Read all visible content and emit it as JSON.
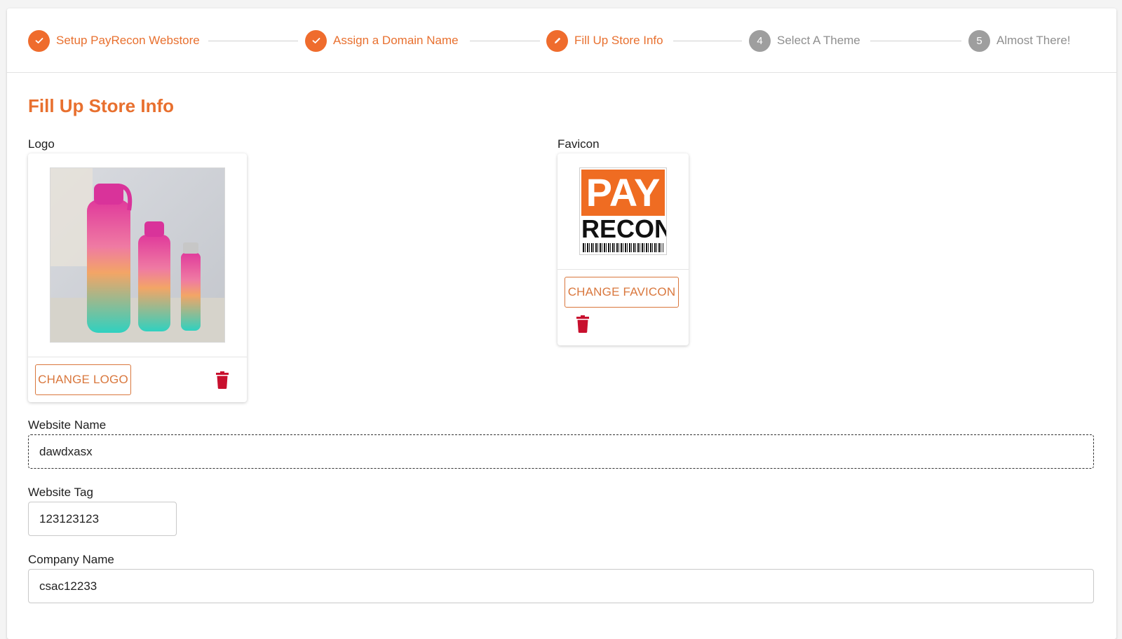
{
  "stepper": {
    "steps": [
      {
        "number": "",
        "label": "Setup PayRecon Webstore",
        "status": "completed"
      },
      {
        "number": "",
        "label": "Assign a Domain Name",
        "status": "completed"
      },
      {
        "number": "",
        "label": "Fill Up Store Info",
        "status": "current"
      },
      {
        "number": "4",
        "label": "Select A Theme",
        "status": "pending"
      },
      {
        "number": "5",
        "label": "Almost There!",
        "status": "pending"
      }
    ]
  },
  "page": {
    "title": "Fill Up Store Info"
  },
  "logo": {
    "label": "Logo",
    "change_label": "CHANGE LOGO"
  },
  "favicon": {
    "label": "Favicon",
    "change_label": "CHANGE FAVICON",
    "logo_text_top": "PAY",
    "logo_text_bottom": "RECON"
  },
  "form": {
    "website_name": {
      "label": "Website Name",
      "value": "dawdxasx"
    },
    "website_tag": {
      "label": "Website Tag",
      "value": "123123123"
    },
    "company_name": {
      "label": "Company Name",
      "value": "csac12233"
    }
  },
  "colors": {
    "accent": "#e8702f",
    "danger": "#c8102e",
    "inactive": "#9e9e9e"
  },
  "icons": {
    "completed": "check-icon",
    "current": "pencil-icon",
    "delete": "trash-icon"
  }
}
